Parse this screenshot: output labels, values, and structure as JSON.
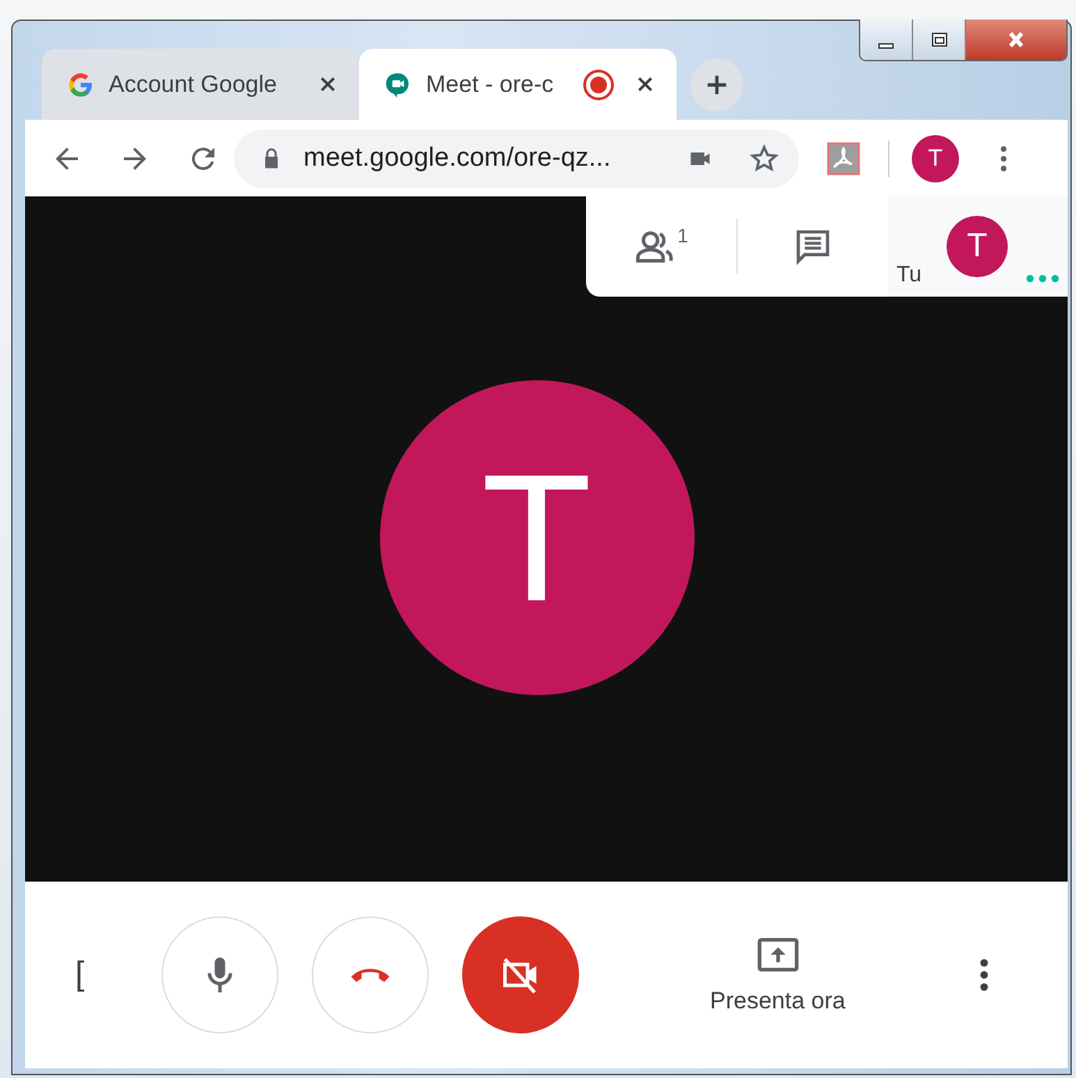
{
  "window": {
    "controls": [
      {
        "kind": "minimize"
      },
      {
        "kind": "maximize"
      },
      {
        "kind": "close"
      }
    ]
  },
  "tabs": [
    {
      "title": "Account Google",
      "kind": "google",
      "selected": false,
      "recording": false
    },
    {
      "title": "Meet - ore-c",
      "kind": "meet",
      "selected": true,
      "recording": true
    }
  ],
  "toolbar": {
    "url": "meet.google.com/ore-qz...",
    "profile_initial": "T"
  },
  "meeting": {
    "participants_count": "1",
    "self_label": "Tu",
    "self_initial": "T",
    "main_initial": "T"
  },
  "controls": {
    "details_partial": "[",
    "mic_on": true,
    "camera_on": false,
    "present_label": "Presenta ora"
  }
}
